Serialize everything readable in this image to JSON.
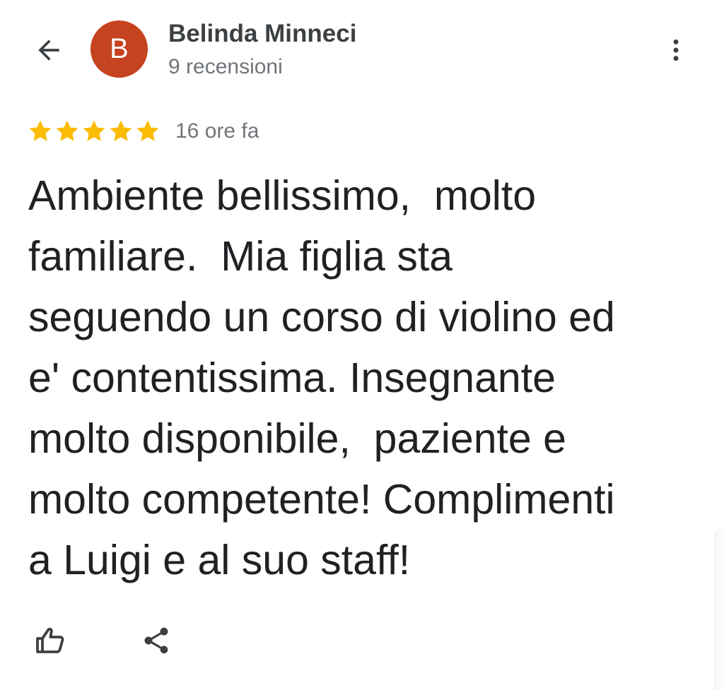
{
  "header": {
    "back_icon": "arrow-back-icon",
    "avatar_letter": "B",
    "avatar_color": "#c5431e",
    "user_name": "Belinda Minneci",
    "review_count": "9 recensioni",
    "menu_icon": "more-vertical-icon"
  },
  "review": {
    "rating": 5,
    "rating_max": 5,
    "star_color": "#fbbc04",
    "time": "16 ore fa",
    "text_lines": [
      "Ambiente bellissimo,  molto",
      "familiare.  Mia figlia sta",
      "seguendo un corso di violino ed",
      "e' contentissima. Insegnante",
      "molto disponibile,  paziente e",
      "molto competente! Complimenti",
      "a Luigi e al suo staff!"
    ]
  },
  "actions": {
    "like_icon": "thumbs-up-icon",
    "share_icon": "share-icon"
  }
}
